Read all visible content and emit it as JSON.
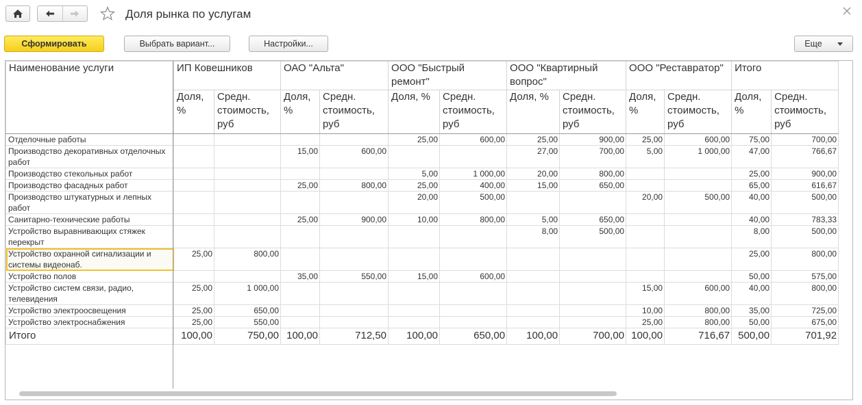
{
  "window": {
    "title": "Доля рынка по услугам",
    "icons": [
      "home-icon",
      "back-arrow-icon",
      "forward-arrow-icon",
      "favorite-star-icon",
      "close-icon"
    ]
  },
  "toolbar": {
    "generate_label": "Сформировать",
    "variant_label": "Выбрать вариант...",
    "settings_label": "Настройки...",
    "more_label": "Еще"
  },
  "colors": {
    "primary_button": "#f5cf1a",
    "selection": "#f3c12a",
    "grid_line": "#dcdcdc"
  },
  "report": {
    "name_header": "Наименование услуги",
    "columns": [
      "ИП Ковешников",
      "ОАО \"Альта\"",
      "ООО \"Быстрый ремонт\"",
      "ООО \"Квартирный вопрос\"",
      "ООО \"Реставратор\"",
      "Итого"
    ],
    "share_header": "Доля, %",
    "cost_header": "Средн. стоимость, руб",
    "rows": [
      {
        "name": "Отделочные работы",
        "v": [
          "",
          "",
          "",
          "",
          "25,00",
          "600,00",
          "25,00",
          "900,00",
          "25,00",
          "600,00",
          "75,00",
          "700,00"
        ]
      },
      {
        "name": "Производство декоративных отделочных работ",
        "v": [
          "",
          "",
          "15,00",
          "600,00",
          "",
          "",
          "27,00",
          "700,00",
          "5,00",
          "1 000,00",
          "47,00",
          "766,67"
        ]
      },
      {
        "name": "Производство стекольных работ",
        "v": [
          "",
          "",
          "",
          "",
          "5,00",
          "1 000,00",
          "20,00",
          "800,00",
          "",
          "",
          "25,00",
          "900,00"
        ]
      },
      {
        "name": "Производство фасадных работ",
        "v": [
          "",
          "",
          "25,00",
          "800,00",
          "25,00",
          "400,00",
          "15,00",
          "650,00",
          "",
          "",
          "65,00",
          "616,67"
        ]
      },
      {
        "name": "Производство штукатурных и лепных работ",
        "v": [
          "",
          "",
          "",
          "",
          "20,00",
          "500,00",
          "",
          "",
          "20,00",
          "500,00",
          "40,00",
          "500,00"
        ]
      },
      {
        "name": "Санитарно-технические работы",
        "v": [
          "",
          "",
          "25,00",
          "900,00",
          "10,00",
          "800,00",
          "5,00",
          "650,00",
          "",
          "",
          "40,00",
          "783,33"
        ]
      },
      {
        "name": "Устройство выравнивающих стяжек перекрыт",
        "v": [
          "",
          "",
          "",
          "",
          "",
          "",
          "8,00",
          "500,00",
          "",
          "",
          "8,00",
          "500,00"
        ]
      },
      {
        "name": "Устройство охранной сигнализации и системы видеонаб.",
        "v": [
          "25,00",
          "800,00",
          "",
          "",
          "",
          "",
          "",
          "",
          "",
          "",
          "25,00",
          "800,00"
        ]
      },
      {
        "name": "Устройство полов",
        "v": [
          "",
          "",
          "35,00",
          "550,00",
          "15,00",
          "600,00",
          "",
          "",
          "",
          "",
          "50,00",
          "575,00"
        ]
      },
      {
        "name": "Устройство систем связи, радио, телевидения",
        "v": [
          "25,00",
          "1 000,00",
          "",
          "",
          "",
          "",
          "",
          "",
          "15,00",
          "600,00",
          "40,00",
          "800,00"
        ]
      },
      {
        "name": "Устройство электроосвещения",
        "v": [
          "25,00",
          "650,00",
          "",
          "",
          "",
          "",
          "",
          "",
          "10,00",
          "800,00",
          "35,00",
          "725,00"
        ]
      },
      {
        "name": "Устройство электроснабжения",
        "v": [
          "25,00",
          "550,00",
          "",
          "",
          "",
          "",
          "",
          "",
          "25,00",
          "800,00",
          "50,00",
          "675,00"
        ]
      }
    ],
    "total": {
      "name": "Итого",
      "v": [
        "100,00",
        "750,00",
        "100,00",
        "712,50",
        "100,00",
        "650,00",
        "100,00",
        "700,00",
        "100,00",
        "716,67",
        "500,00",
        "701,92"
      ]
    }
  }
}
